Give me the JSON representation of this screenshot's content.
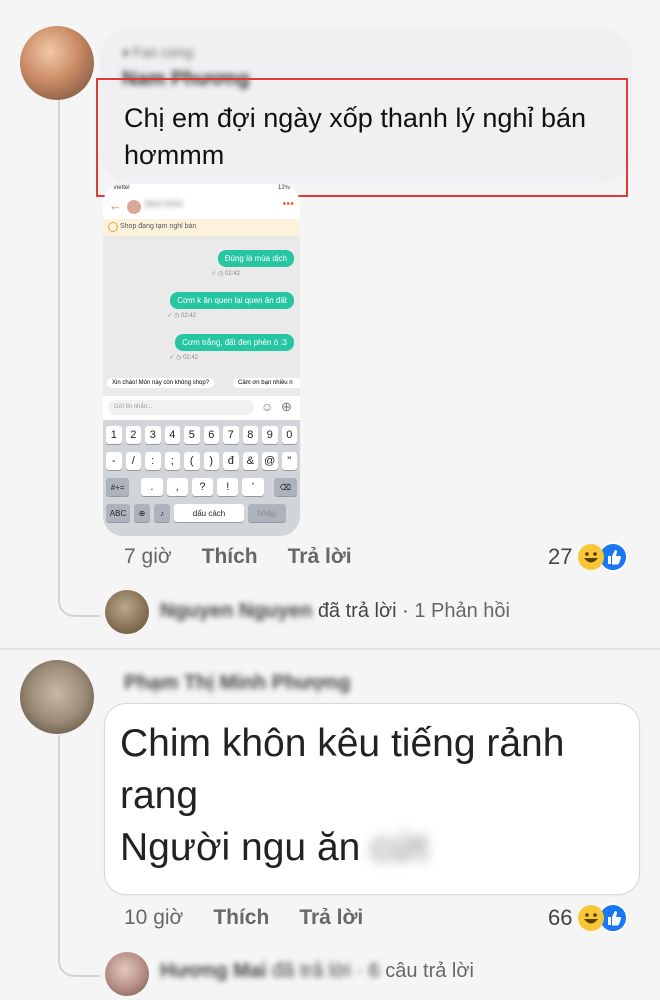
{
  "comment1": {
    "author_tag": "Fan cứng",
    "author_name": "Nam Phương",
    "text_line1": "Chị em đợi ngày xốp thanh lý nghỉ bán",
    "text_line2": "hơmmm",
    "time": "7 giờ",
    "like_label": "Thích",
    "reply_label": "Trả lời",
    "reaction_count": "27",
    "reply_summary": {
      "name": "Nguyen Nguyen",
      "action": "đã trả lời",
      "dot": "·",
      "count": "1 Phản hồi"
    },
    "highlight_color": "#e03a3a"
  },
  "phone": {
    "status_left": "Viettel",
    "status_right": "12%",
    "shop_name": "Mosu Home",
    "banner": "Shop đang tạm nghỉ bán",
    "messages": [
      {
        "text": "Đúng là mùa dịch",
        "time": "02:42"
      },
      {
        "text": "Cơm k ăn quen lại quen ăn đất",
        "time": "02:42"
      },
      {
        "text": "Cơm trắng, đất đen phèn ó :3",
        "time": "02:42"
      }
    ],
    "quick_replies": [
      "Xin chào! Món này còn không shop?",
      "Cảm ơn bạn nhiều n"
    ],
    "input_placeholder": "Gửi tin nhắn...",
    "keys_row1": [
      "1",
      "2",
      "3",
      "4",
      "5",
      "6",
      "7",
      "8",
      "9",
      "0"
    ],
    "keys_row2": [
      "-",
      "/",
      ":",
      ";",
      "(",
      ")",
      "đ",
      "&",
      "@",
      "\""
    ],
    "keys_row3": [
      ".",
      ",",
      "?",
      "!",
      "'"
    ],
    "key_symbols": "#+=",
    "key_abc": "ABC",
    "key_space": "dấu cách",
    "key_enter": "Nhập"
  },
  "comment2": {
    "author_name": "Phạm Thị Minh Phượng",
    "text_line1": "Chim khôn kêu tiếng rảnh",
    "text_line2": "rang",
    "text_line3": "Người ngu ăn",
    "text_blur": "cứt",
    "time": "10 giờ",
    "like_label": "Thích",
    "reply_label": "Trả lời",
    "reaction_count": "66",
    "reply_summary": {
      "name": "Hương Mai",
      "action": "đã trả lời",
      "dot": "·",
      "count_blur": "6",
      "count": "câu trả lời"
    }
  },
  "icons": {
    "reactions": [
      "haha-icon",
      "like-icon"
    ],
    "badge": "fan-badge-icon"
  }
}
